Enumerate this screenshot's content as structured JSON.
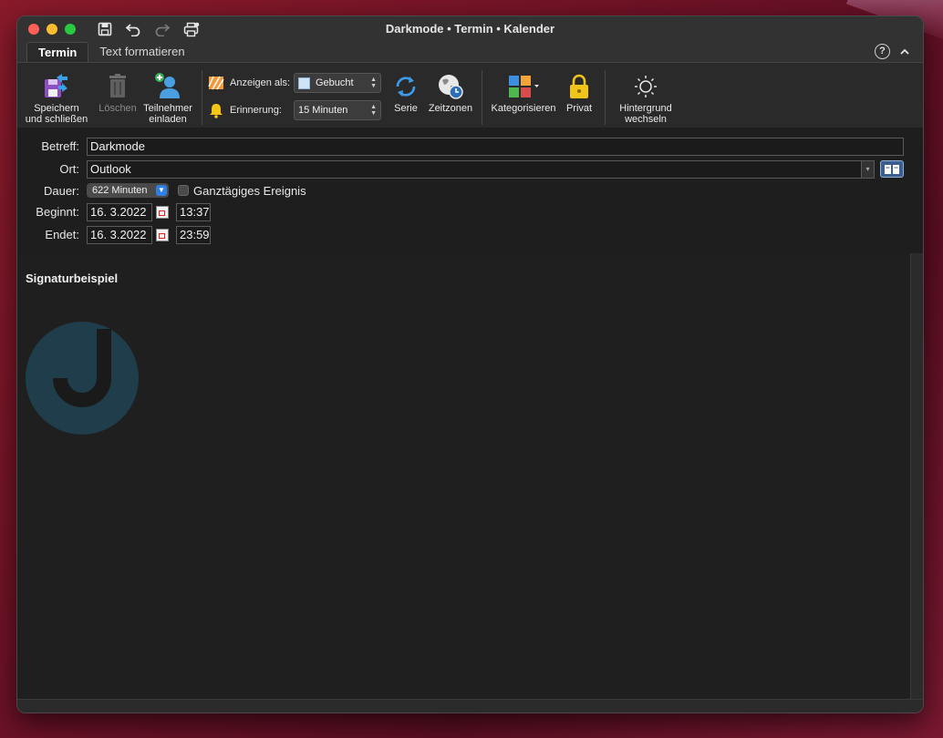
{
  "window": {
    "title": "Darkmode • Termin • Kalender"
  },
  "tabs": [
    {
      "label": "Termin",
      "active": true
    },
    {
      "label": "Text formatieren",
      "active": false
    }
  ],
  "help_label": "?",
  "ribbon": {
    "save_close": {
      "line1": "Speichern",
      "line2": "und schließen"
    },
    "delete": {
      "label": "Löschen"
    },
    "invite": {
      "line1": "Teilnehmer",
      "line2": "einladen"
    },
    "show_as": {
      "label": "Anzeigen als:",
      "value": "Gebucht"
    },
    "reminder": {
      "label": "Erinnerung:",
      "value": "15 Minuten"
    },
    "series": {
      "label": "Serie"
    },
    "timezones": {
      "label": "Zeitzonen"
    },
    "categorize": {
      "label": "Kategorisieren"
    },
    "private": {
      "label": "Privat"
    },
    "background": {
      "line1": "Hintergrund",
      "line2": "wechseln"
    }
  },
  "form": {
    "subject": {
      "label": "Betreff:",
      "value": "Darkmode"
    },
    "location": {
      "label": "Ort:",
      "value": "Outlook"
    },
    "duration": {
      "label": "Dauer:",
      "value": "622 Minuten",
      "allday_label": "Ganztägiges Ereignis"
    },
    "start": {
      "label": "Beginnt:",
      "date": "16.  3.2022",
      "time": "13:37"
    },
    "end": {
      "label": "Endet:",
      "date": "16.  3.2022",
      "time": "23:59"
    }
  },
  "body": {
    "signature_title": "Signaturbeispiel"
  },
  "colors": {
    "logo": "#1f3d4a",
    "accent": "#2f7fe5"
  }
}
